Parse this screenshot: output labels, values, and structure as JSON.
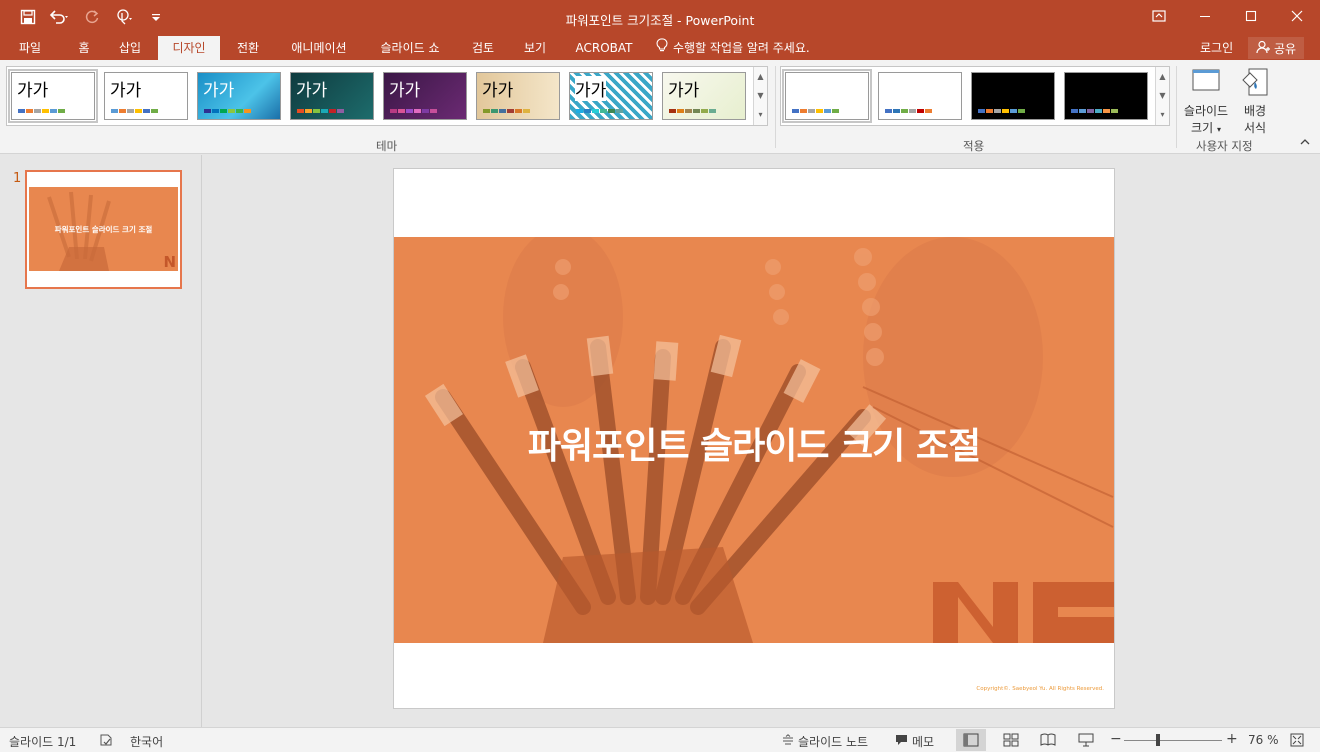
{
  "window": {
    "title": "파워포인트 크기조절 - PowerPoint"
  },
  "quick_access": {
    "icons": [
      "save-icon",
      "undo-icon",
      "redo-icon",
      "touch-mode-icon",
      "customize-icon"
    ]
  },
  "tabs": [
    {
      "label": "파일"
    },
    {
      "label": "홈"
    },
    {
      "label": "삽입"
    },
    {
      "label": "디자인",
      "active": true
    },
    {
      "label": "전환"
    },
    {
      "label": "애니메이션"
    },
    {
      "label": "슬라이드 쇼"
    },
    {
      "label": "검토"
    },
    {
      "label": "보기"
    },
    {
      "label": "ACROBAT"
    }
  ],
  "tell_me": "수행할 작업을 알려 주세요.",
  "account": {
    "login": "로그인",
    "share": "공유"
  },
  "ribbon": {
    "themes": {
      "group_label": "테마",
      "sample": "가가"
    },
    "variants": {
      "group_label": "적용"
    },
    "customize": {
      "group_label": "사용자 지정",
      "slide_size_line1": "슬라이드",
      "slide_size_line2": "크기",
      "background_line1": "배경",
      "background_line2": "서식"
    }
  },
  "slides_pane": {
    "number": "1",
    "thumb_title": "파워포인트 슬라이드 크기 조절"
  },
  "slide": {
    "title": "파워포인트 슬라이드 크기 조절",
    "copyright": "Copyright©. Saebyeol Yu. All Rights Reserved."
  },
  "status": {
    "slide_counter": "슬라이드 1/1",
    "language": "한국어",
    "notes": "슬라이드 노트",
    "comments": "메모",
    "zoom": "76 %"
  },
  "colors": {
    "accent": "#b7472a",
    "slide_band": "#e8874f"
  }
}
